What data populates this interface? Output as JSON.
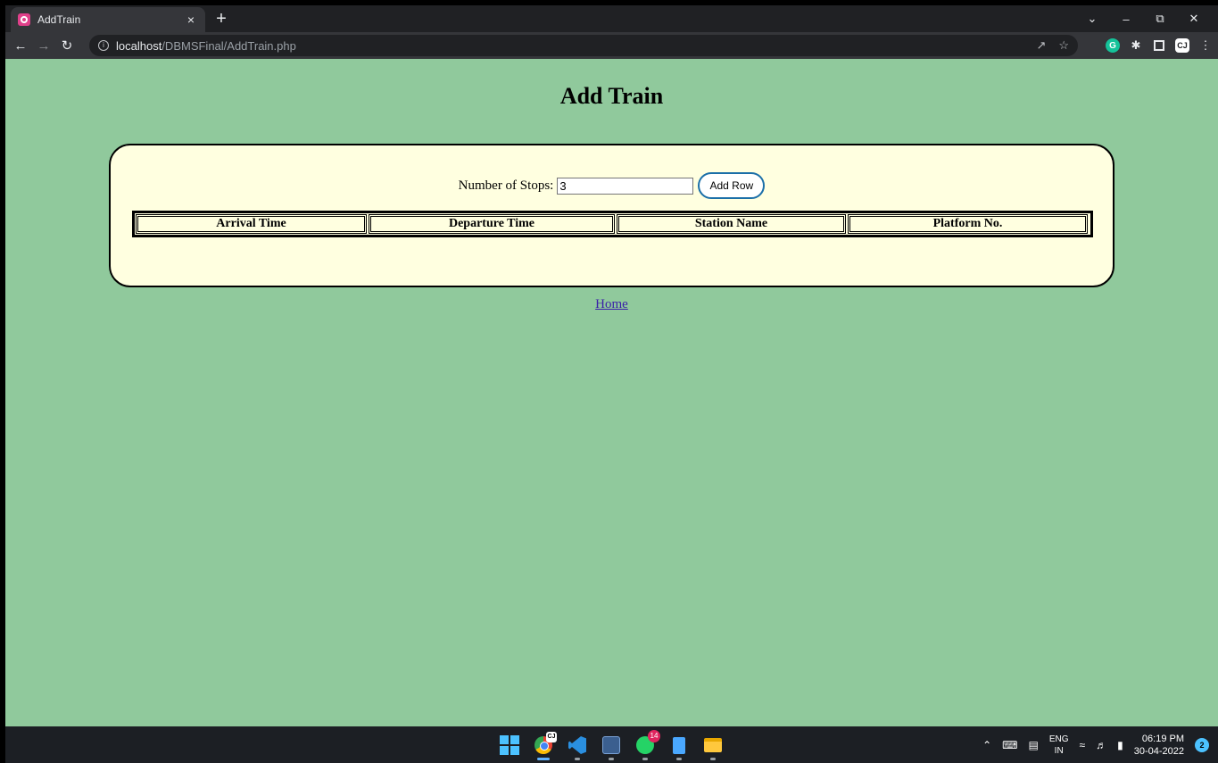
{
  "browser": {
    "tab_title": "AddTrain",
    "tab_close": "×",
    "new_tab": "+",
    "url_host": "localhost",
    "url_path": "/DBMSFinal/AddTrain.php"
  },
  "page": {
    "title": "Add Train",
    "stops_label": "Number of Stops:",
    "stops_value": "3",
    "add_row_label": "Add Row",
    "table_headers": [
      "Arrival Time",
      "Departure Time",
      "Station Name",
      "Platform No."
    ],
    "home_link": "Home"
  },
  "taskbar": {
    "lang_top": "ENG",
    "lang_bottom": "IN",
    "time": "06:19 PM",
    "date": "30-04-2022",
    "whatsapp_badge": "14",
    "notification_count": "2",
    "chrome_badge": "CJ"
  },
  "colors": {
    "page_background": "#90c99c",
    "card_background": "#ffffe0",
    "button_border": "#1b6fa8"
  }
}
